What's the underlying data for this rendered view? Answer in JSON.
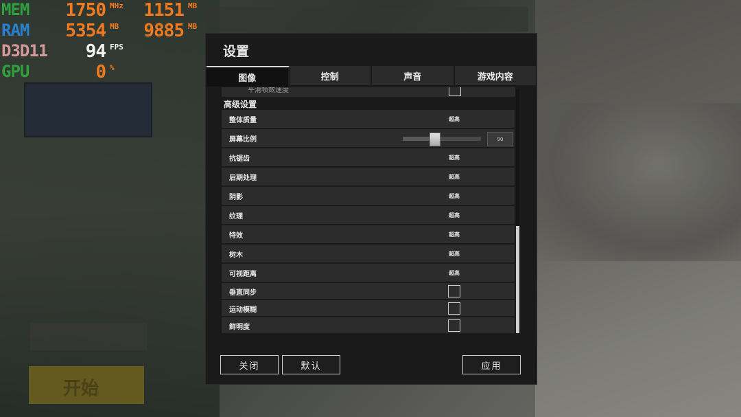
{
  "overlay": {
    "mem": {
      "label": "MEM",
      "value1": "1750",
      "unit1": "MHz",
      "value2": "1151",
      "unit2": "MB"
    },
    "ram": {
      "label": "RAM",
      "value1": "5354",
      "unit1": "MB",
      "value2": "9885",
      "unit2": "MB"
    },
    "d3d": {
      "label": "D3D11",
      "value1": "94",
      "unit1": "FPS"
    },
    "gpu": {
      "label": "GPU",
      "value1": "0",
      "unit1": "%"
    }
  },
  "background": {
    "start_label": "开始"
  },
  "dialog": {
    "title": "设置",
    "tabs": [
      {
        "label": "图像",
        "active": true
      },
      {
        "label": "控制",
        "active": false
      },
      {
        "label": "声音",
        "active": false
      },
      {
        "label": "游戏内容",
        "active": false
      }
    ],
    "partial_row_label": "平滑帧数速度",
    "section_title": "高级设置",
    "settings": [
      {
        "label": "整体质量",
        "value": "超高"
      },
      {
        "label": "屏幕比例",
        "slider_value": "90",
        "slider_level": 0.4
      },
      {
        "label": "抗锯齿",
        "value": "超高"
      },
      {
        "label": "后期处理",
        "value": "超高"
      },
      {
        "label": "阴影",
        "value": "超高"
      },
      {
        "label": "纹理",
        "value": "超高"
      },
      {
        "label": "特效",
        "value": "超高"
      },
      {
        "label": "树木",
        "value": "超高"
      },
      {
        "label": "可视距离",
        "value": "超高"
      },
      {
        "label": "垂直同步",
        "checked": false
      },
      {
        "label": "运动模糊",
        "checked": false
      },
      {
        "label": "鲜明度",
        "checked": false
      }
    ],
    "buttons": {
      "close": "关闭",
      "default": "默认",
      "apply": "应用"
    }
  }
}
